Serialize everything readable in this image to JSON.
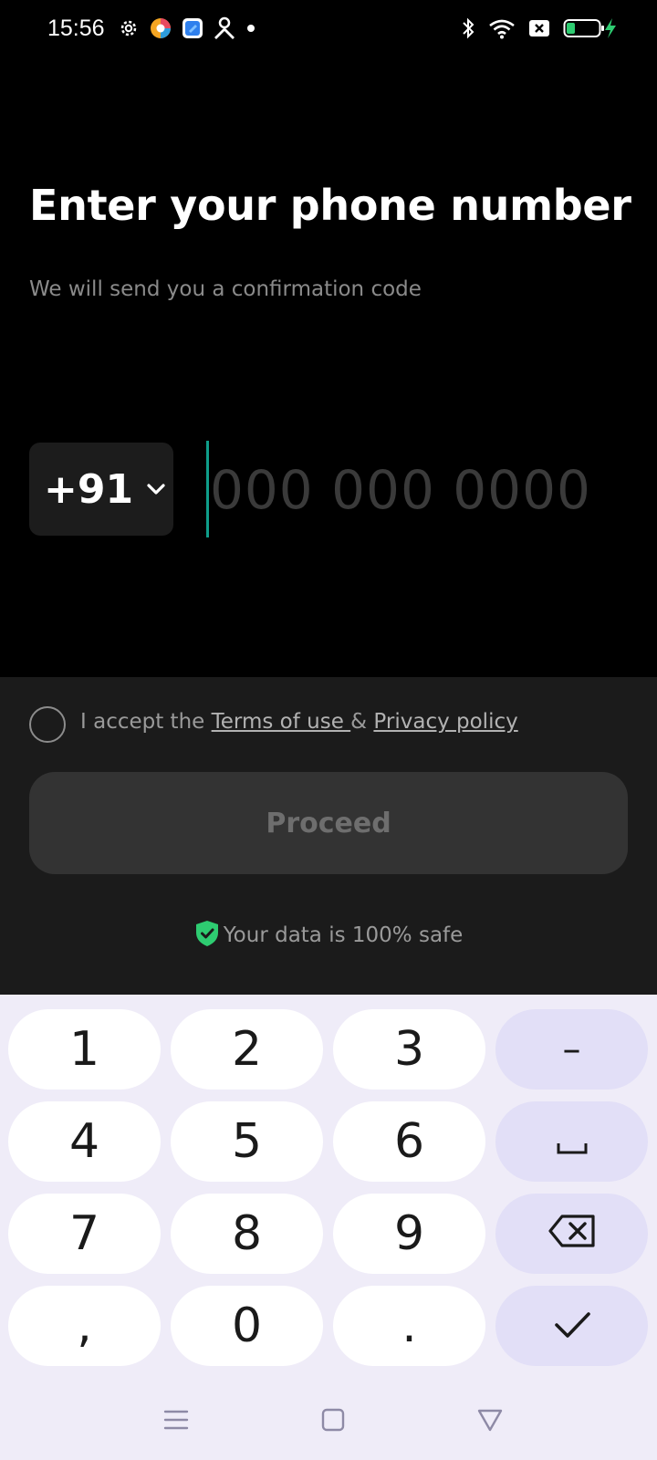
{
  "status_bar": {
    "time": "15:56",
    "icons": [
      "gear-icon",
      "browser-icon",
      "files-icon",
      "person-icon",
      "notification-dot-icon",
      "bluetooth-icon",
      "wifi-icon",
      "sim-off-icon",
      "battery-icon",
      "charging-bolt-icon"
    ]
  },
  "header": {
    "title": "Enter your phone number",
    "subtitle": "We will send you a confirmation code"
  },
  "phone": {
    "country_code": "+91",
    "placeholder": "000 000 0000",
    "value": ""
  },
  "consent": {
    "prefix": "I accept the ",
    "terms_link": "Terms of use ",
    "joiner": "& ",
    "privacy_link": "Privacy policy ",
    "checked": false
  },
  "proceed_label": "Proceed",
  "safe_note": "Your data is 100% safe",
  "keyboard": {
    "keys": {
      "k1": "1",
      "k2": "2",
      "k3": "3",
      "dash": "–",
      "k4": "4",
      "k5": "5",
      "k6": "6",
      "k7": "7",
      "k8": "8",
      "k9": "9",
      "comma": ",",
      "k0": "0",
      "period": "."
    },
    "func_icons": [
      "dash-key",
      "space-icon",
      "backspace-icon",
      "check-icon"
    ]
  },
  "nav_icons": [
    "menu-icon",
    "home-icon",
    "back-icon"
  ],
  "colors": {
    "background": "#000000",
    "panel": "#1b1b1b",
    "accent_cursor": "#0f9e8a",
    "safe_shield": "#2ecc71",
    "keyboard_bg": "#efecf8",
    "function_key": "#e2dff7"
  }
}
